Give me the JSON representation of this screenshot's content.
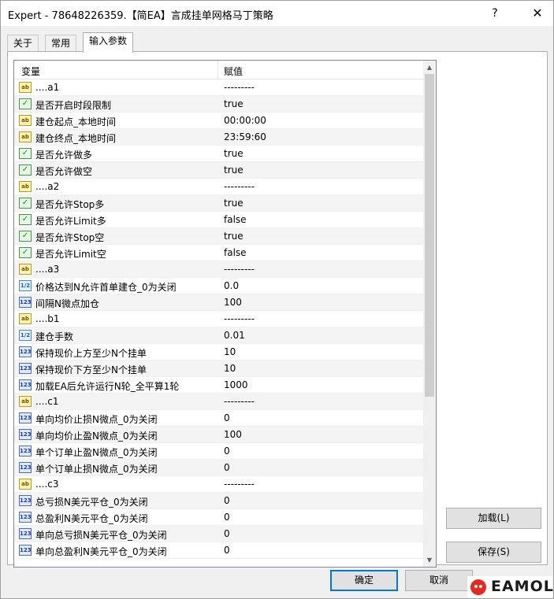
{
  "window": {
    "title": "Expert - 78648226359.【简EA】言成挂单网格马丁策略",
    "help": "?",
    "close": "✕"
  },
  "tabs": [
    {
      "label": "关于",
      "active": false
    },
    {
      "label": "常用",
      "active": false
    },
    {
      "label": "输入参数",
      "active": true
    }
  ],
  "grid": {
    "col_variable": "变量",
    "col_value": "赋值",
    "rows": [
      {
        "icon": "ab",
        "name": "....a1",
        "value": "---------"
      },
      {
        "icon": "bool",
        "name": "是否开启时段限制",
        "value": "true"
      },
      {
        "icon": "ab",
        "name": "建仓起点_本地时间",
        "value": "00:00:00"
      },
      {
        "icon": "ab",
        "name": "建仓终点_本地时间",
        "value": "23:59:60"
      },
      {
        "icon": "bool",
        "name": "是否允许做多",
        "value": "true"
      },
      {
        "icon": "bool",
        "name": "是否允许做空",
        "value": "true"
      },
      {
        "icon": "ab",
        "name": "....a2",
        "value": "---------"
      },
      {
        "icon": "bool",
        "name": "是否允许Stop多",
        "value": "true"
      },
      {
        "icon": "bool",
        "name": "是否允许Limit多",
        "value": "false"
      },
      {
        "icon": "bool",
        "name": "是否允许Stop空",
        "value": "true"
      },
      {
        "icon": "bool",
        "name": "是否允许Limit空",
        "value": "false"
      },
      {
        "icon": "ab",
        "name": "....a3",
        "value": "---------"
      },
      {
        "icon": "dbl",
        "name": "价格达到N允许首单建仓_0为关闭",
        "value": "0.0"
      },
      {
        "icon": "int",
        "name": "间隔N微点加仓",
        "value": "100"
      },
      {
        "icon": "ab",
        "name": "....b1",
        "value": "---------"
      },
      {
        "icon": "dbl",
        "name": "建仓手数",
        "value": "0.01"
      },
      {
        "icon": "int",
        "name": "保持现价上方至少N个挂单",
        "value": "10"
      },
      {
        "icon": "int",
        "name": "保持现价下方至少N个挂单",
        "value": "10"
      },
      {
        "icon": "int",
        "name": "加载EA后允许运行N轮_全平算1轮",
        "value": "1000"
      },
      {
        "icon": "ab",
        "name": "....c1",
        "value": "---------"
      },
      {
        "icon": "int",
        "name": "单向均价止损N微点_0为关闭",
        "value": "0"
      },
      {
        "icon": "int",
        "name": "单向均价止盈N微点_0为关闭",
        "value": "100"
      },
      {
        "icon": "int",
        "name": "单个订单止盈N微点_0为关闭",
        "value": "0"
      },
      {
        "icon": "int",
        "name": "单个订单止损N微点_0为关闭",
        "value": "0"
      },
      {
        "icon": "ab",
        "name": "....c3",
        "value": "---------"
      },
      {
        "icon": "int",
        "name": "总亏损N美元平仓_0为关闭",
        "value": "0"
      },
      {
        "icon": "int",
        "name": "总盈利N美元平仓_0为关闭",
        "value": "0"
      },
      {
        "icon": "int",
        "name": "单向总亏损N美元平仓_0为关闭",
        "value": "0"
      },
      {
        "icon": "int",
        "name": "单向总盈利N美元平仓_0为关闭",
        "value": "0"
      }
    ]
  },
  "icons": {
    "ab": "ab",
    "bool": "✓",
    "int": "123",
    "dbl": "1/2"
  },
  "buttons": {
    "load": "加载(L)",
    "save": "保存(S)",
    "ok": "确定",
    "cancel": "取消"
  },
  "watermark": {
    "text": "EAMOL",
    "color": "#e8281e"
  },
  "colors": {
    "default_button_border": "#0078d7"
  }
}
